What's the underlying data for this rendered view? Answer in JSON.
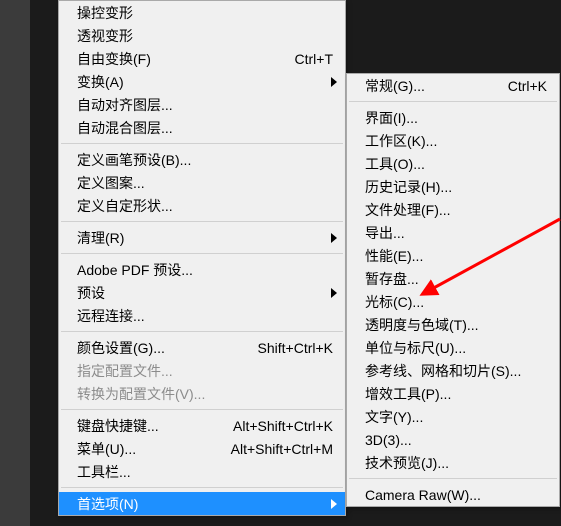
{
  "menu1": {
    "groups": [
      [
        {
          "label": "操控变形",
          "interact": true
        },
        {
          "label": "透视变形",
          "interact": true
        },
        {
          "label": "自由变换(F)",
          "shortcut": "Ctrl+T",
          "interact": true
        },
        {
          "label": "变换(A)",
          "submenu": true,
          "interact": true
        },
        {
          "label": "自动对齐图层...",
          "interact": true
        },
        {
          "label": "自动混合图层...",
          "interact": true
        }
      ],
      [
        {
          "label": "定义画笔预设(B)...",
          "interact": true
        },
        {
          "label": "定义图案...",
          "interact": true
        },
        {
          "label": "定义自定形状...",
          "interact": true
        }
      ],
      [
        {
          "label": "清理(R)",
          "submenu": true,
          "interact": true
        }
      ],
      [
        {
          "label": "Adobe PDF 预设...",
          "interact": true
        },
        {
          "label": "预设",
          "submenu": true,
          "interact": true
        },
        {
          "label": "远程连接...",
          "interact": true
        }
      ],
      [
        {
          "label": "颜色设置(G)...",
          "shortcut": "Shift+Ctrl+K",
          "interact": true
        },
        {
          "label": "指定配置文件...",
          "disabled": true,
          "interact": false
        },
        {
          "label": "转换为配置文件(V)...",
          "disabled": true,
          "interact": false
        }
      ],
      [
        {
          "label": "键盘快捷键...",
          "shortcut": "Alt+Shift+Ctrl+K",
          "interact": true
        },
        {
          "label": "菜单(U)...",
          "shortcut": "Alt+Shift+Ctrl+M",
          "interact": true
        },
        {
          "label": "工具栏...",
          "interact": true
        }
      ],
      [
        {
          "label": "首选项(N)",
          "submenu": true,
          "selected": true,
          "interact": true
        }
      ]
    ]
  },
  "menu2": {
    "groups": [
      [
        {
          "label": "常规(G)...",
          "shortcut": "Ctrl+K",
          "interact": true
        }
      ],
      [
        {
          "label": "界面(I)...",
          "interact": true
        },
        {
          "label": "工作区(K)...",
          "interact": true
        },
        {
          "label": "工具(O)...",
          "interact": true
        },
        {
          "label": "历史记录(H)...",
          "interact": true
        },
        {
          "label": "文件处理(F)...",
          "interact": true
        },
        {
          "label": "导出...",
          "interact": true
        },
        {
          "label": "性能(E)...",
          "interact": true
        },
        {
          "label": "暂存盘...",
          "interact": true
        },
        {
          "label": "光标(C)...",
          "interact": true
        },
        {
          "label": "透明度与色域(T)...",
          "interact": true
        },
        {
          "label": "单位与标尺(U)...",
          "interact": true
        },
        {
          "label": "参考线、网格和切片(S)...",
          "interact": true
        },
        {
          "label": "增效工具(P)...",
          "interact": true
        },
        {
          "label": "文字(Y)...",
          "interact": true
        },
        {
          "label": "3D(3)...",
          "interact": true
        },
        {
          "label": "技术预览(J)...",
          "interact": true
        }
      ],
      [
        {
          "label": "Camera Raw(W)...",
          "interact": true
        }
      ]
    ]
  },
  "annotation": {
    "type": "arrow",
    "color": "#ff0000",
    "target": "暂存盘..."
  }
}
